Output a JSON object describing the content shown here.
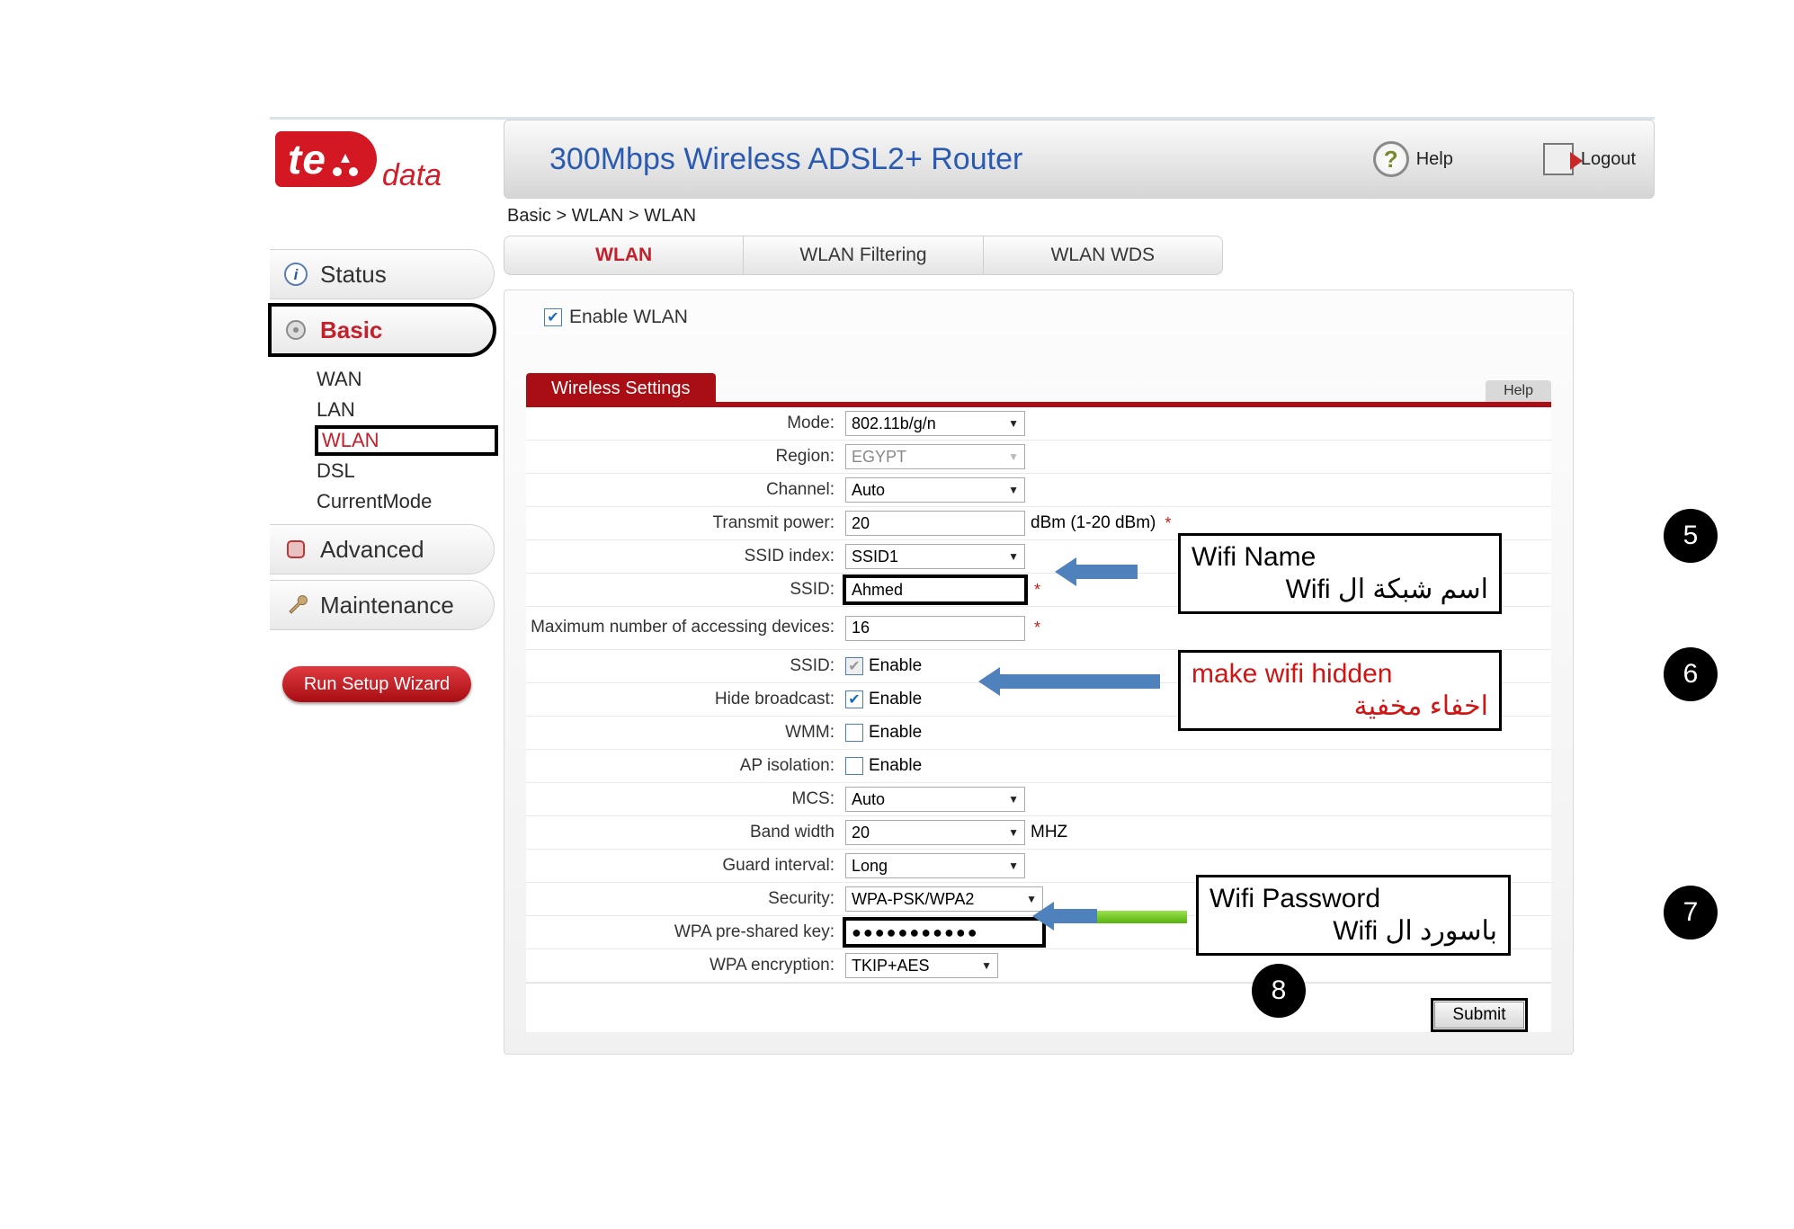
{
  "logo": {
    "brand": "te",
    "suffix": "data"
  },
  "header": {
    "title": "300Mbps Wireless ADSL2+ Router",
    "help": "Help",
    "logout": "Logout"
  },
  "breadcrumb": "Basic > WLAN > WLAN",
  "nav": {
    "status": "Status",
    "basic": "Basic",
    "basic_sub": [
      "WAN",
      "LAN",
      "WLAN",
      "DSL",
      "CurrentMode"
    ],
    "advanced": "Advanced",
    "maintenance": "Maintenance",
    "wizard": "Run Setup Wizard"
  },
  "tabs": {
    "wlan": "WLAN",
    "filtering": "WLAN Filtering",
    "wds": "WLAN WDS"
  },
  "enable_wlan_label": "Enable WLAN",
  "panel": {
    "title": "Wireless Settings",
    "help": "Help"
  },
  "form": {
    "mode": {
      "label": "Mode:",
      "value": "802.11b/g/n"
    },
    "region": {
      "label": "Region:",
      "value": "EGYPT"
    },
    "channel": {
      "label": "Channel:",
      "value": "Auto"
    },
    "tx_power": {
      "label": "Transmit power:",
      "value": "20",
      "unit": "dBm (1-20 dBm)"
    },
    "ssid_index": {
      "label": "SSID index:",
      "value": "SSID1"
    },
    "ssid": {
      "label": "SSID:",
      "value": "Ahmed"
    },
    "max_devices": {
      "label": "Maximum number of accessing devices:",
      "value": "16"
    },
    "ssid_enable": {
      "label": "SSID:",
      "text": "Enable"
    },
    "hide_broadcast": {
      "label": "Hide broadcast:",
      "text": "Enable"
    },
    "wmm": {
      "label": "WMM:",
      "text": "Enable"
    },
    "ap_isolation": {
      "label": "AP isolation:",
      "text": "Enable"
    },
    "mcs": {
      "label": "MCS:",
      "value": "Auto"
    },
    "bandwidth": {
      "label": "Band width",
      "value": "20",
      "unit": "MHZ"
    },
    "guard": {
      "label": "Guard interval:",
      "value": "Long"
    },
    "security": {
      "label": "Security:",
      "value": "WPA-PSK/WPA2"
    },
    "psk": {
      "label": "WPA pre-shared key:",
      "value": "●●●●●●●●●●●"
    },
    "encryption": {
      "label": "WPA encryption:",
      "value": "TKIP+AES"
    }
  },
  "submit": "Submit",
  "annotations": {
    "a5": {
      "num": "5",
      "en": "Wifi Name",
      "ar": "اسم شبكة ال   Wifi"
    },
    "a6": {
      "num": "6",
      "en": "make wifi hidden",
      "ar": "اخفاء مخفية"
    },
    "a7": {
      "num": "7",
      "en": "Wifi Password",
      "ar": "باسورد ال   Wifi"
    },
    "a8": {
      "num": "8"
    }
  }
}
